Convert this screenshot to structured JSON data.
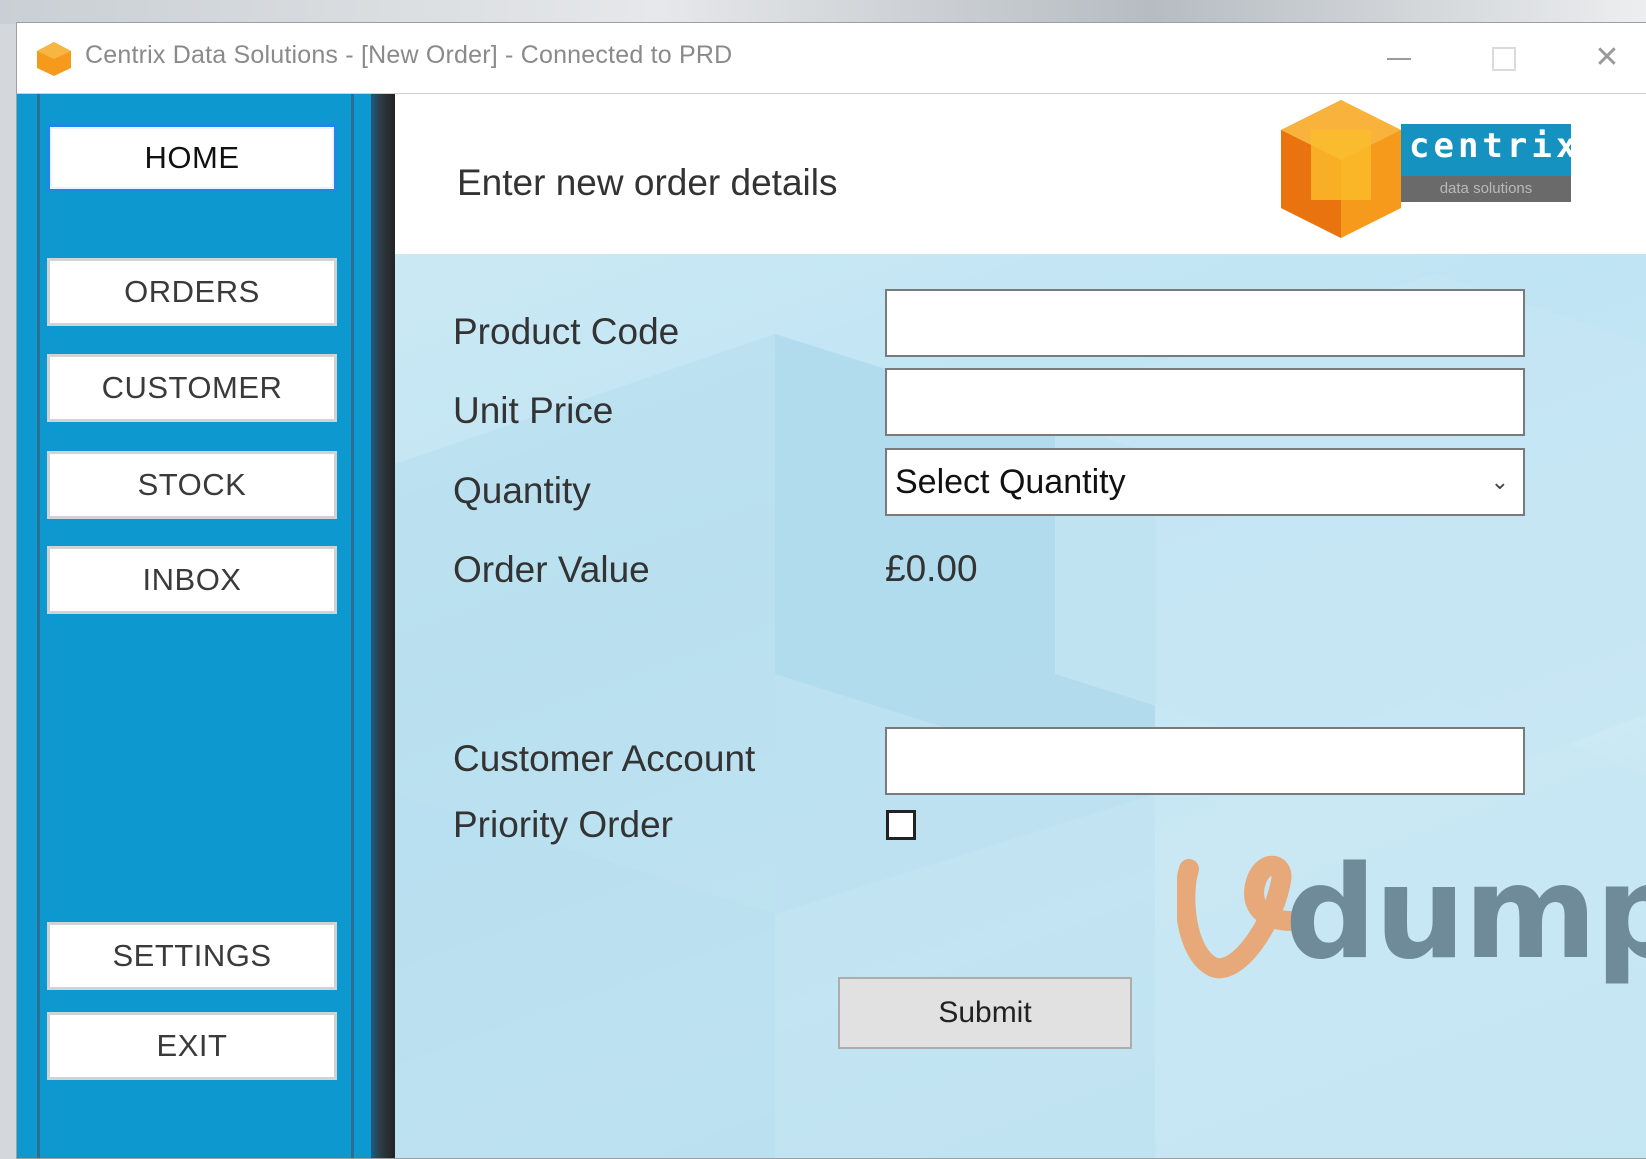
{
  "window": {
    "title": "Centrix Data Solutions - [New Order] - Connected to PRD",
    "controls": {
      "minimize": "–",
      "maximize": "□",
      "close": "✕"
    }
  },
  "sidebar": {
    "items": [
      {
        "label": "HOME",
        "active": true
      },
      {
        "label": "ORDERS"
      },
      {
        "label": "CUSTOMER"
      },
      {
        "label": "STOCK"
      },
      {
        "label": "INBOX"
      },
      {
        "label": "SETTINGS"
      },
      {
        "label": "EXIT"
      }
    ],
    "color": "#0d99cf"
  },
  "header": {
    "title": "Enter new order details",
    "logo": {
      "word": "centrix",
      "sub": "data solutions"
    }
  },
  "form": {
    "product_code": {
      "label": "Product Code",
      "value": ""
    },
    "unit_price": {
      "label": "Unit Price",
      "value": ""
    },
    "quantity": {
      "label": "Quantity",
      "selected": "Select Quantity"
    },
    "order_value": {
      "label": "Order Value",
      "value": "£0.00"
    },
    "customer_account": {
      "label": "Customer Account",
      "value": ""
    },
    "priority_order": {
      "label": "Priority Order",
      "checked": false
    },
    "submit_label": "Submit"
  },
  "watermark": {
    "text": "dump"
  },
  "icons": {
    "app": "app-logo-icon",
    "chevron": "chevron-down-icon"
  },
  "colors": {
    "accent": "#1e88e5",
    "logo_orange": "#f59a1b",
    "logo_teal": "#1592bf"
  }
}
